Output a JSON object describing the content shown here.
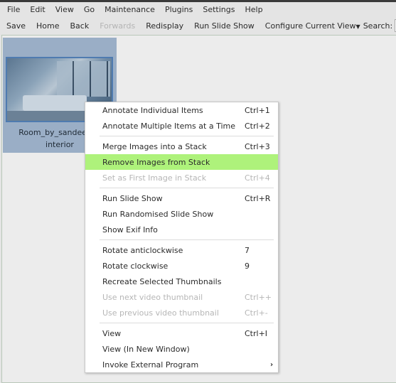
{
  "menubar": [
    "File",
    "Edit",
    "View",
    "Go",
    "Maintenance",
    "Plugins",
    "Settings",
    "Help"
  ],
  "toolbar": {
    "save": "Save",
    "home": "Home",
    "back": "Back",
    "forwards": "Forwards",
    "redisplay": "Redisplay",
    "slideshow": "Run Slide Show",
    "configure": "Configure Current View",
    "search_label": "Search:"
  },
  "thumbnail": {
    "caption_line1": "Room_by_sandeepds",
    "caption_line2": "interior"
  },
  "context_menu": {
    "highlight_color": "#aef27b",
    "items": [
      {
        "label": "Annotate Individual Items",
        "shortcut": "Ctrl+1"
      },
      {
        "label": "Annotate Multiple Items at a Time",
        "shortcut": "Ctrl+2"
      },
      {
        "label": "Merge Images into a Stack",
        "shortcut": "Ctrl+3"
      },
      {
        "label": "Remove Images from Stack",
        "shortcut": "",
        "highlighted": true
      },
      {
        "label": "Set as First Image in Stack",
        "shortcut": "Ctrl+4",
        "disabled": true
      },
      {
        "label": "Run Slide Show",
        "shortcut": "Ctrl+R"
      },
      {
        "label": "Run Randomised Slide Show",
        "shortcut": ""
      },
      {
        "label": "Show Exif Info",
        "shortcut": ""
      },
      {
        "label": "Rotate anticlockwise",
        "shortcut": "7"
      },
      {
        "label": "Rotate clockwise",
        "shortcut": "9"
      },
      {
        "label": "Recreate Selected Thumbnails",
        "shortcut": ""
      },
      {
        "label": "Use next video thumbnail",
        "shortcut": "Ctrl++",
        "disabled": true
      },
      {
        "label": "Use previous video thumbnail",
        "shortcut": "Ctrl+-",
        "disabled": true
      },
      {
        "label": "View",
        "shortcut": "Ctrl+I"
      },
      {
        "label": "View (In New Window)",
        "shortcut": ""
      },
      {
        "label": "Invoke External Program",
        "shortcut": "",
        "submenu": true,
        "arrow": "›"
      }
    ]
  }
}
